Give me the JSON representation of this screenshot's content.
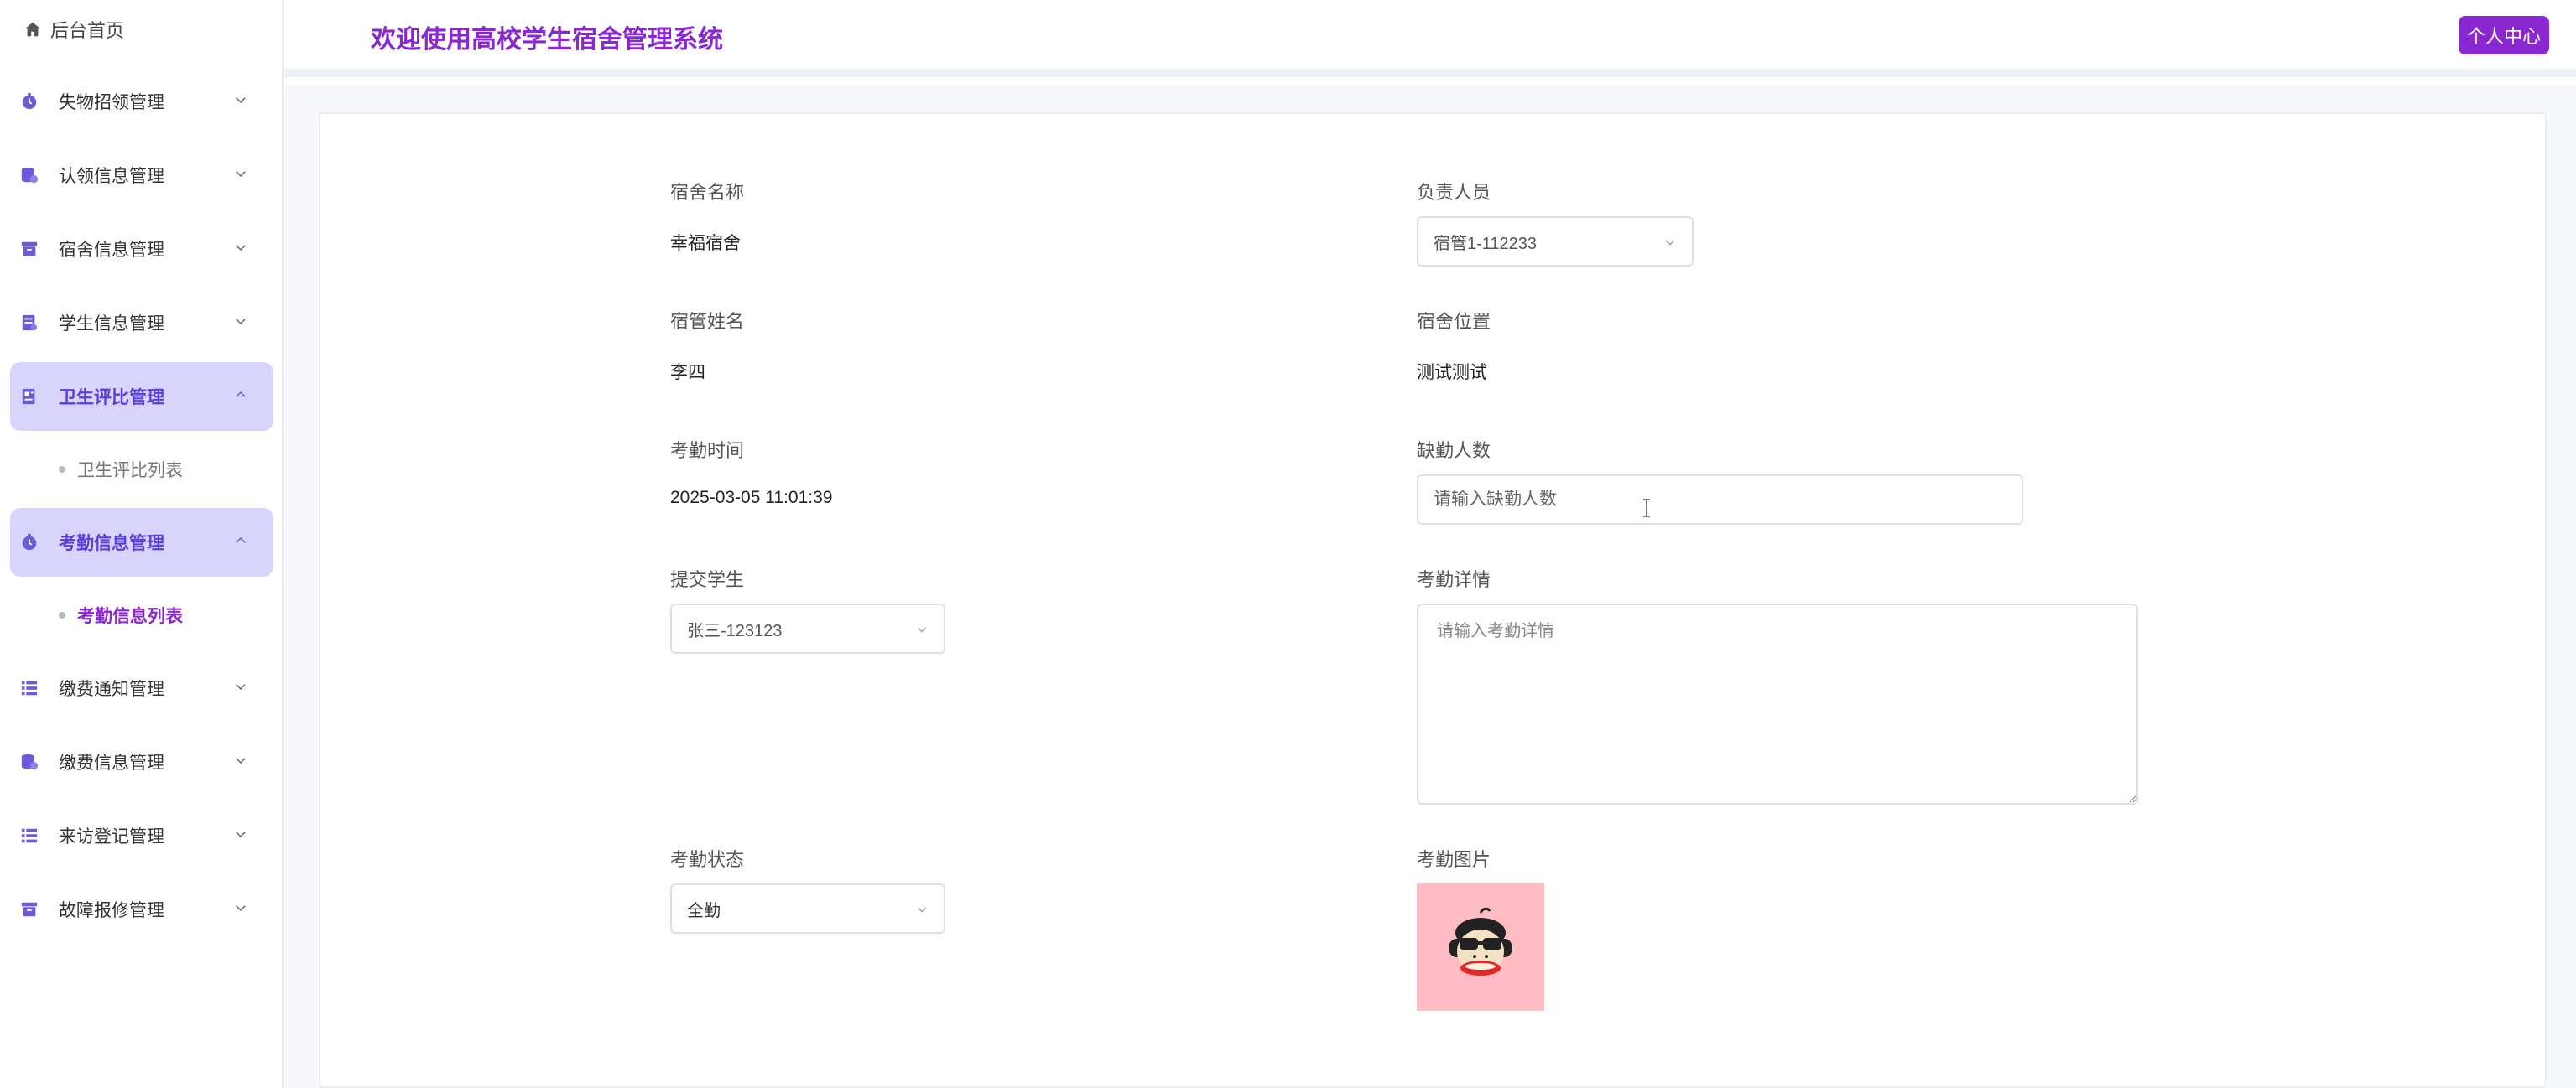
{
  "sidebar": {
    "home_label": "后台首页",
    "items": [
      {
        "label": "失物招领管理",
        "icon": "clock-icon",
        "open": false
      },
      {
        "label": "认领信息管理",
        "icon": "database-icon",
        "open": false
      },
      {
        "label": "宿舍信息管理",
        "icon": "archive-icon",
        "open": false
      },
      {
        "label": "学生信息管理",
        "icon": "document-icon",
        "open": false
      },
      {
        "label": "卫生评比管理",
        "icon": "report-icon",
        "open": true,
        "sub": [
          {
            "label": "卫生评比列表",
            "active": false
          }
        ]
      },
      {
        "label": "考勤信息管理",
        "icon": "clock-icon",
        "open": true,
        "sub": [
          {
            "label": "考勤信息列表",
            "active": true
          }
        ]
      },
      {
        "label": "缴费通知管理",
        "icon": "list-icon",
        "open": false
      },
      {
        "label": "缴费信息管理",
        "icon": "database-icon",
        "open": false
      },
      {
        "label": "来访登记管理",
        "icon": "list-icon",
        "open": false
      },
      {
        "label": "故障报修管理",
        "icon": "archive-icon",
        "open": false
      }
    ]
  },
  "header": {
    "welcome": "欢迎使用高校学生宿舍管理系统",
    "personal_center": "个人中心"
  },
  "form": {
    "dorm_name_label": "宿舍名称",
    "dorm_name_value": "幸福宿舍",
    "manager_label": "负责人员",
    "manager_value": "宿管1-112233",
    "warden_name_label": "宿管姓名",
    "warden_name_value": "李四",
    "location_label": "宿舍位置",
    "location_value": "测试测试",
    "time_label": "考勤时间",
    "time_value": "2025-03-05 11:01:39",
    "absent_label": "缺勤人数",
    "absent_placeholder": "请输入缺勤人数",
    "student_label": "提交学生",
    "student_value": "张三-123123",
    "detail_label": "考勤详情",
    "detail_placeholder": "请输入考勤详情",
    "status_label": "考勤状态",
    "status_value": "全勤",
    "image_label": "考勤图片"
  },
  "colors": {
    "accent": "#8a27d0",
    "menu_open_bg": "#d8d4fb",
    "menu_icon": "#6b5bd6",
    "image_bg": "#ffbdc3"
  }
}
